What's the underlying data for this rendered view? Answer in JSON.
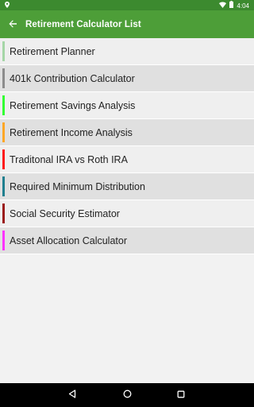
{
  "status_bar": {
    "time": "4:04"
  },
  "app_bar": {
    "title": "Retirement Calculator List",
    "back_icon": "arrow-back-icon"
  },
  "list": {
    "items": [
      {
        "label": "Retirement Planner",
        "accent": "#a5d6a7"
      },
      {
        "label": "401k Contribution Calculator",
        "accent": "#8c8c8c"
      },
      {
        "label": "Retirement Savings Analysis",
        "accent": "#33ff33"
      },
      {
        "label": "Retirement Income Analysis",
        "accent": "#ffa726"
      },
      {
        "label": "Traditonal IRA vs Roth IRA",
        "accent": "#ff1a1a"
      },
      {
        "label": "Required Minimum Distribution",
        "accent": "#1f7f8f"
      },
      {
        "label": "Social Security Estimator",
        "accent": "#9b1b1b"
      },
      {
        "label": "Asset Allocation Calculator",
        "accent": "#ff33ff"
      }
    ]
  },
  "colors": {
    "status_bar": "#3c8a2f",
    "app_bar": "#4d9e38"
  }
}
